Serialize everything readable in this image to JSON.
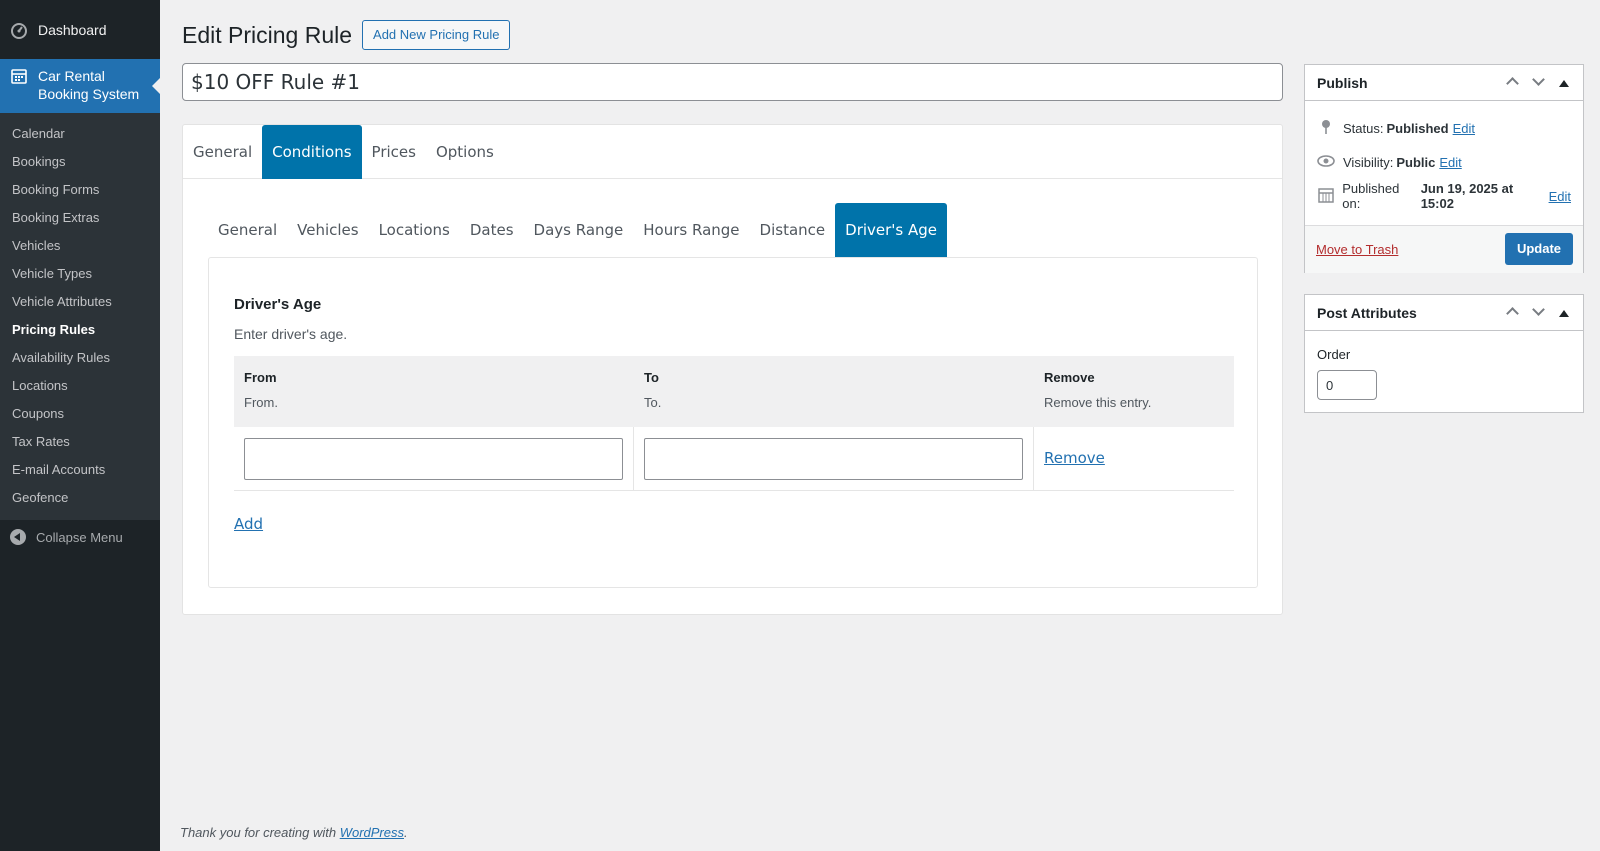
{
  "sidebar": {
    "dashboard_label": "Dashboard",
    "current_menu_label": "Car Rental Booking System",
    "items": [
      {
        "label": "Calendar"
      },
      {
        "label": "Bookings"
      },
      {
        "label": "Booking Forms"
      },
      {
        "label": "Booking Extras"
      },
      {
        "label": "Vehicles"
      },
      {
        "label": "Vehicle Types"
      },
      {
        "label": "Vehicle Attributes"
      },
      {
        "label": "Pricing Rules"
      },
      {
        "label": "Availability Rules"
      },
      {
        "label": "Locations"
      },
      {
        "label": "Coupons"
      },
      {
        "label": "Tax Rates"
      },
      {
        "label": "E-mail Accounts"
      },
      {
        "label": "Geofence"
      }
    ],
    "collapse_label": "Collapse Menu"
  },
  "header": {
    "title": "Edit Pricing Rule",
    "add_new_label": "Add New Pricing Rule"
  },
  "post_title": "$10 OFF Rule #1",
  "main_tabs": [
    "General",
    "Conditions",
    "Prices",
    "Options"
  ],
  "main_tab_active": "Conditions",
  "condition_tabs": [
    "General",
    "Vehicles",
    "Locations",
    "Dates",
    "Days Range",
    "Hours Range",
    "Distance",
    "Driver's Age"
  ],
  "condition_tab_active": "Driver's Age",
  "drivers_age": {
    "title": "Driver's Age",
    "description": "Enter driver's age.",
    "columns": [
      {
        "title": "From",
        "desc": "From."
      },
      {
        "title": "To",
        "desc": "To."
      },
      {
        "title": "Remove",
        "desc": "Remove this entry."
      }
    ],
    "row": {
      "from": "",
      "to": "",
      "remove_label": "Remove"
    },
    "add_label": "Add"
  },
  "publish": {
    "title": "Publish",
    "status_label": "Status:",
    "status_value": "Published",
    "visibility_label": "Visibility:",
    "visibility_value": "Public",
    "published_label": "Published on:",
    "published_value": "Jun 19, 2025 at 15:02",
    "edit_label": "Edit",
    "trash_label": "Move to Trash",
    "update_label": "Update"
  },
  "post_attributes": {
    "title": "Post Attributes",
    "order_label": "Order",
    "order_value": "0"
  },
  "footer": {
    "text": "Thank you for creating with ",
    "link": "WordPress",
    "end": "."
  },
  "colors": {
    "accent": "#2271b1",
    "tab_active": "#0073aa",
    "sidebar_bg": "#1d2327",
    "trash": "#b32d2e"
  }
}
